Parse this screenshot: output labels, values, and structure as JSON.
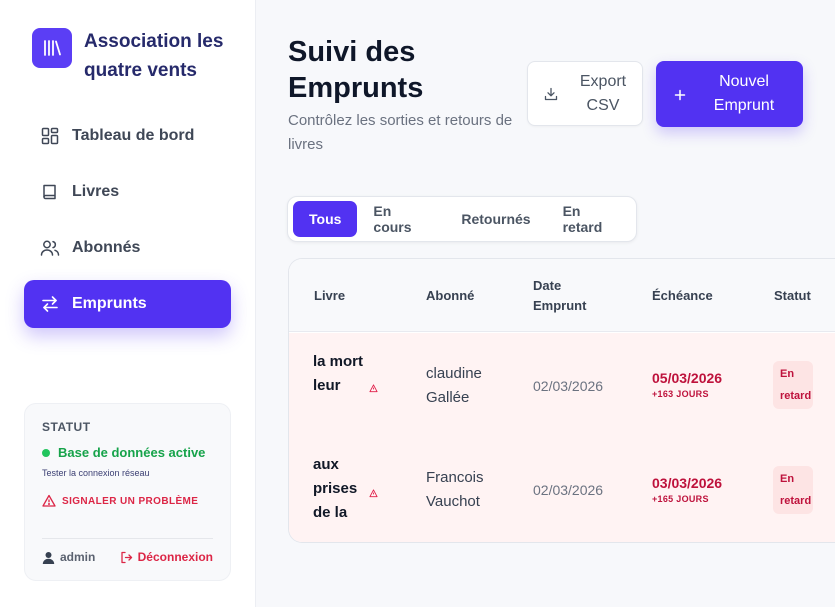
{
  "app": {
    "name": "Association les quatre vents"
  },
  "sidebar": {
    "items": [
      {
        "label": "Tableau de bord",
        "icon": "dashboard-icon"
      },
      {
        "label": "Livres",
        "icon": "book-icon"
      },
      {
        "label": "Abonnés",
        "icon": "users-icon"
      },
      {
        "label": "Emprunts",
        "icon": "swap-icon",
        "active": true
      }
    ],
    "status": {
      "title": "STATUT",
      "db": "Base de données active",
      "test_link": "Tester la connexion réseau",
      "report": "SIGNALER UN PROBLÈME",
      "user": "admin",
      "logout": "Déconnexion"
    }
  },
  "header": {
    "title": "Suivi des Emprunts",
    "subtitle": "Contrôlez les sorties et retours de livres",
    "export_label": "Export CSV",
    "new_label": "Nouvel Emprunt"
  },
  "tabs": [
    {
      "label": "Tous",
      "active": true
    },
    {
      "label": "En cours"
    },
    {
      "label": "Retournés"
    },
    {
      "label": "En retard"
    }
  ],
  "table": {
    "columns": [
      "Livre",
      "Abonné",
      "Date Emprunt",
      "Échéance",
      "Statut"
    ],
    "rows": [
      {
        "book": "la mort leur",
        "subscriber": "claudine Gallée",
        "borrow_date": "02/03/2026",
        "due_date": "05/03/2026",
        "due_info": "+163 JOURS",
        "status": "En retard"
      },
      {
        "book": "aux prises de la",
        "subscriber": "Francois Vauchot",
        "borrow_date": "02/03/2026",
        "due_date": "03/03/2026",
        "due_info": "+165 JOURS",
        "status": "En retard"
      }
    ]
  },
  "colors": {
    "accent": "#5232f2",
    "danger": "#be123c",
    "success": "#16a34a",
    "overdue_row": "#fff3f3"
  }
}
